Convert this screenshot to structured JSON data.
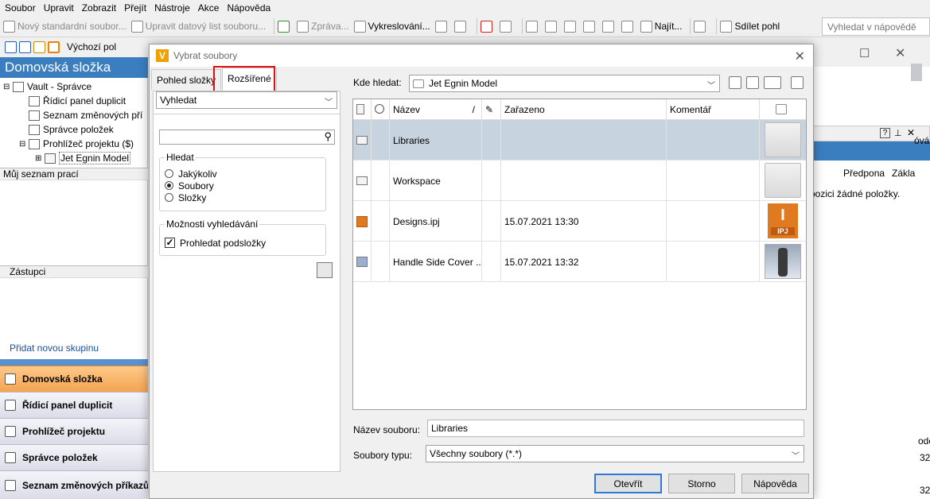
{
  "menu": [
    "Soubor",
    "Upravit",
    "Zobrazit",
    "Přejít",
    "Nástroje",
    "Akce",
    "Nápověda"
  ],
  "toolbar": {
    "new_file": "Nový standardní soubor...",
    "edit_datasheet": "Upravit datový list souboru...",
    "messages": "Zpráva...",
    "drawing": "Vykreslování...",
    "find": "Najít...",
    "share": "Sdílet pohl",
    "help_search_placeholder": "Vyhledat v nápovědě",
    "default_view": "Výchozí pol"
  },
  "left": {
    "title": "Domovská složka",
    "tree": [
      "Vault - Správce",
      "Řídicí panel duplicit",
      "Seznam změnových pří",
      "Správce položek",
      "Prohlížeč projektu ($)",
      "Jet Egnin Model"
    ],
    "worklist": "Můj seznam prací",
    "delegates": "Zástupci",
    "add_group": "Přidat novou skupinu",
    "nav": [
      "Domovská složka",
      "Řídicí panel duplicit",
      "Prohlížeč projektu",
      "Správce položek",
      "Seznam změnových příkazů"
    ]
  },
  "right": {
    "col_prefix": "Předpona",
    "col_base": "Zákla",
    "empty": "pozici žádné položky.",
    "frag_1": "óvá",
    "frag_2": "ode",
    "frag_3": "32",
    "frag_4": "32"
  },
  "dialog": {
    "title": "Vybrat soubory",
    "tab_folders": "Pohled složky",
    "tab_advanced": "Rozšířené",
    "search_mode": "Vyhledat",
    "search_group": "Hledat",
    "radio_any": "Jakýkoliv",
    "radio_files": "Soubory",
    "radio_folders": "Složky",
    "options_group": "Možnosti vyhledávání",
    "subfolders": "Prohledat podsložky",
    "lookin_label": "Kde hledat:",
    "lookin_value": "Jet Egnin Model",
    "col_name": "Název",
    "col_sort": "/",
    "col_checkedin": "Zařazeno",
    "col_comment": "Komentář",
    "rows": [
      {
        "name": "Libraries",
        "date": "",
        "comment": "",
        "thumb": "folder"
      },
      {
        "name": "Workspace",
        "date": "",
        "comment": "",
        "thumb": "folder"
      },
      {
        "name": "Designs.ipj",
        "date": "15.07.2021 13:30",
        "comment": "",
        "thumb": "ipj"
      },
      {
        "name": "Handle Side Cover ...",
        "date": "15.07.2021 13:32",
        "comment": "",
        "thumb": "part"
      }
    ],
    "ipj_letter": "I",
    "ipj_ext": "IPJ",
    "filename_label": "Název souboru:",
    "filename_value": "Libraries",
    "filetype_label": "Soubory typu:",
    "filetype_value": "Všechny soubory (*.*)",
    "open": "Otevřít",
    "cancel": "Storno",
    "help": "Nápověda"
  },
  "colors": {
    "accent": "#3a7ec0",
    "active_nav": "#f3a550",
    "selection": "#c7d3df",
    "highlight": "#e01010"
  }
}
